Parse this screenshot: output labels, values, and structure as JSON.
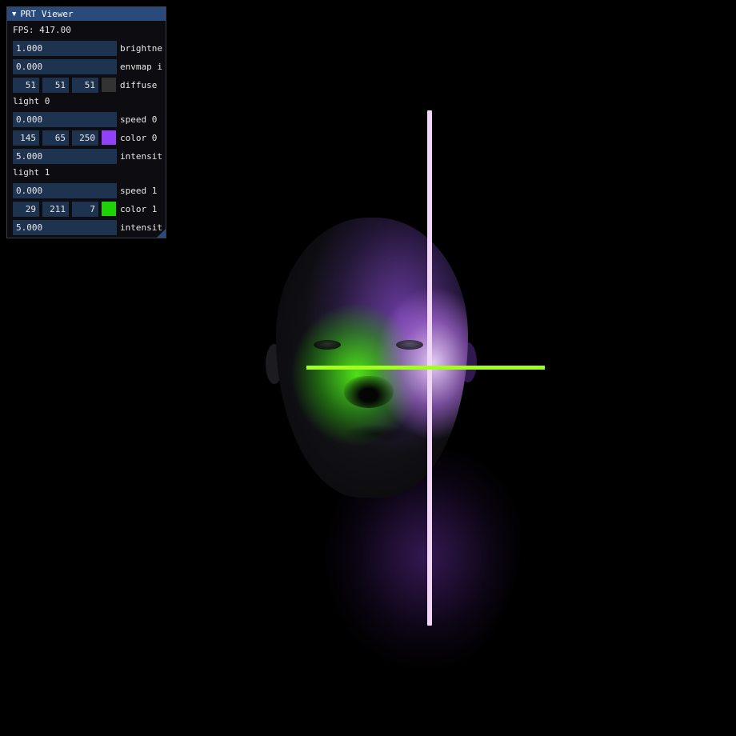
{
  "window": {
    "title": "PRT Viewer",
    "collapse_icon": "triangle-down-icon"
  },
  "fps_text": "FPS: 417.00",
  "controls": {
    "brightness": {
      "value": "1.000",
      "label": "brightne"
    },
    "envmap": {
      "value": "0.000",
      "label": "envmap i"
    },
    "diffuse": {
      "r": "51",
      "g": "51",
      "b": "51",
      "label": "diffuse",
      "color": "#333333"
    }
  },
  "lights": [
    {
      "header": "light 0",
      "speed": {
        "value": "0.000",
        "label": "speed 0"
      },
      "color": {
        "r": "145",
        "g": "65",
        "b": "250",
        "label": "color 0",
        "color": "#9141fa"
      },
      "intensity": {
        "value": "5.000",
        "label": "intensit"
      }
    },
    {
      "header": "light 1",
      "speed": {
        "value": "0.000",
        "label": "speed 1"
      },
      "color": {
        "r": "29",
        "g": "211",
        "b": "7",
        "label": "color 1",
        "color": "#1dd307"
      },
      "intensity": {
        "value": "5.000",
        "label": "intensit"
      }
    }
  ],
  "scene": {
    "axis_vertical_color": "#f2d6f8",
    "axis_horizontal_color": "#a3ff1f"
  }
}
